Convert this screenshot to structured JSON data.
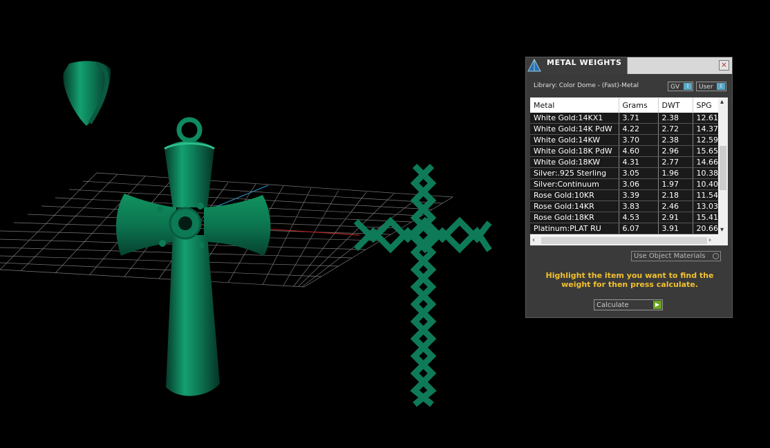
{
  "window": {
    "title": "METAL WEIGHTS",
    "close_label": "×"
  },
  "library_label": "Library: Color Dome - (Fast)-Metal",
  "toggles": {
    "gv": "GV",
    "user": "User"
  },
  "table": {
    "columns": [
      "Metal",
      "Grams",
      "DWT",
      "SPG"
    ],
    "rows": [
      [
        "White Gold:14KX1",
        "3.71",
        "2.38",
        "12.61"
      ],
      [
        "White Gold:14K PdW",
        "4.22",
        "2.72",
        "14.37"
      ],
      [
        "White Gold:14KW",
        "3.70",
        "2.38",
        "12.59"
      ],
      [
        "White Gold:18K PdW",
        "4.60",
        "2.96",
        "15.65"
      ],
      [
        "White Gold:18KW",
        "4.31",
        "2.77",
        "14.66"
      ],
      [
        "Silver:.925 Sterling",
        "3.05",
        "1.96",
        "10.38"
      ],
      [
        "Silver:Continuum",
        "3.06",
        "1.97",
        "10.40"
      ],
      [
        "Rose Gold:10KR",
        "3.39",
        "2.18",
        "11.54"
      ],
      [
        "Rose Gold:14KR",
        "3.83",
        "2.46",
        "13.03"
      ],
      [
        "Rose Gold:18KR",
        "4.53",
        "2.91",
        "15.41"
      ],
      [
        "Platinum:PLAT RU",
        "6.07",
        "3.91",
        "20.66"
      ]
    ]
  },
  "use_object_materials_label": "Use Object Materials",
  "hint_text": "Highlight the item you want to find the weight for then press calculate.",
  "calculate_label": "Calculate",
  "colors": {
    "model": "#0e7a58",
    "panel": "#3a3a3a",
    "hint": "#f2c12e",
    "accent": "#5aa9c8",
    "go": "#6aa520"
  }
}
